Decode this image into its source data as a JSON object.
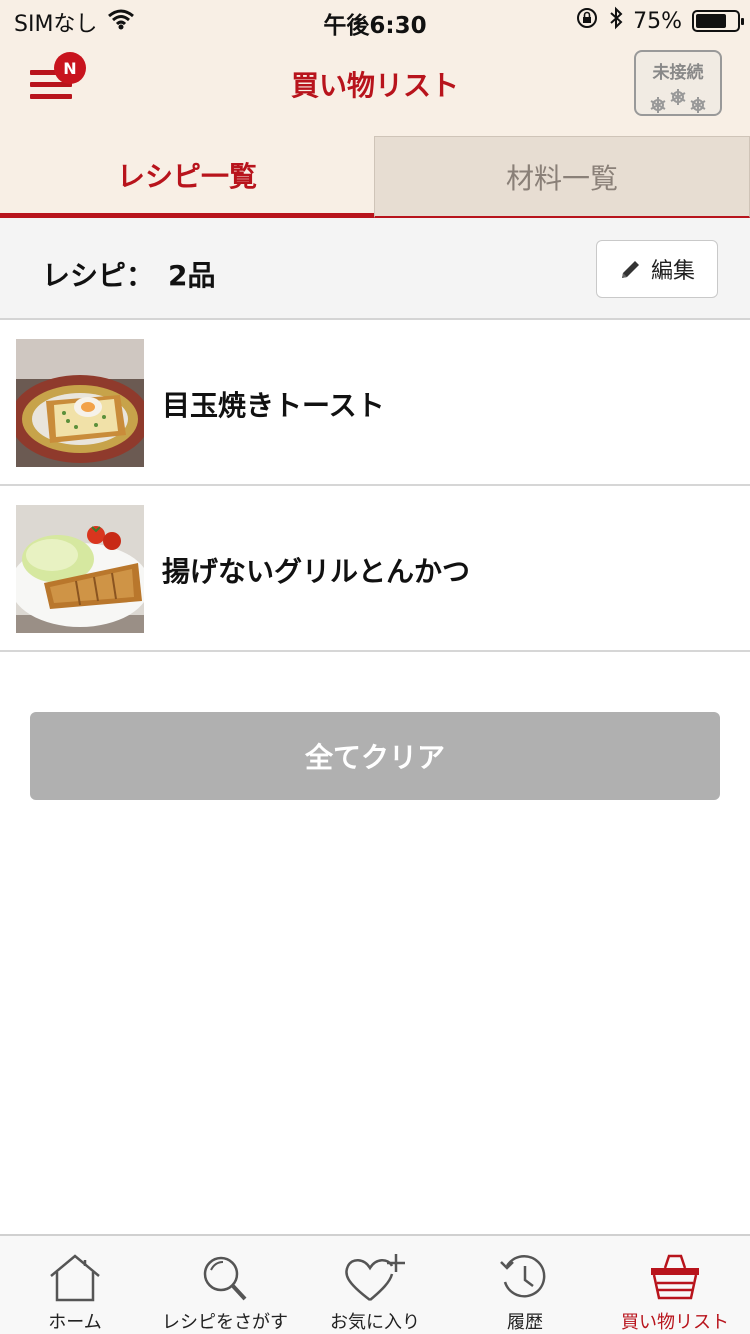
{
  "status_bar": {
    "carrier": "SIMなし",
    "time": "午後6:30",
    "battery_percent": "75%",
    "battery_level": 0.75
  },
  "header": {
    "title": "買い物リスト",
    "menu_badge": "N",
    "connection_status": "未接続"
  },
  "tabs": [
    {
      "label": "レシピ一覧",
      "active": true
    },
    {
      "label": "材料一覧",
      "active": false
    }
  ],
  "summary": {
    "label": "レシピ：",
    "count": "2品",
    "edit_label": "編集"
  },
  "recipes": [
    {
      "name": "目玉焼きトースト"
    },
    {
      "name": "揚げないグリルとんかつ"
    }
  ],
  "clear_all_label": "全てクリア",
  "bottom_nav": [
    {
      "label": "ホーム",
      "icon": "home-icon"
    },
    {
      "label": "レシピをさがす",
      "icon": "search-icon"
    },
    {
      "label": "お気に入り",
      "icon": "heart-plus-icon"
    },
    {
      "label": "履歴",
      "icon": "history-icon"
    },
    {
      "label": "買い物リスト",
      "icon": "basket-icon",
      "active": true
    }
  ],
  "colors": {
    "brand": "#b8141c",
    "header_bg": "#f8efe5",
    "inactive_tab_bg": "#e7ddd2",
    "disabled_button": "#b0b0b0"
  }
}
